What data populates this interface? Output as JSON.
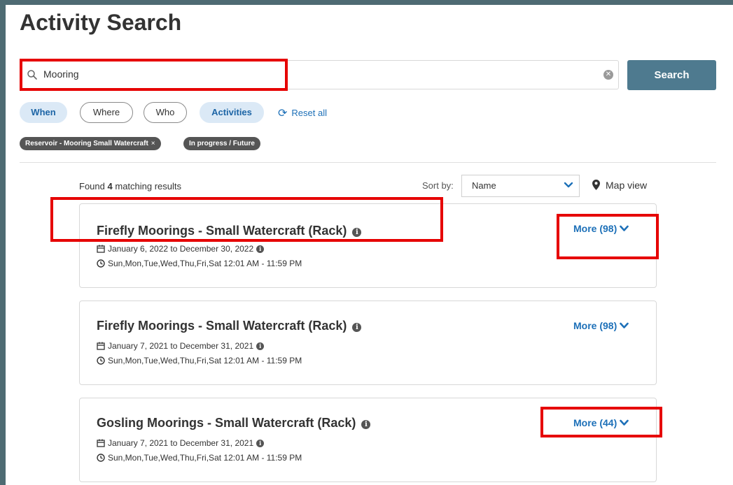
{
  "page": {
    "title": "Activity Search"
  },
  "search": {
    "value": "Mooring",
    "button_label": "Search"
  },
  "filters": {
    "pills": [
      {
        "label": "When",
        "active": true
      },
      {
        "label": "Where",
        "active": false
      },
      {
        "label": "Who",
        "active": false
      },
      {
        "label": "Activities",
        "active": true
      }
    ],
    "reset_label": "Reset all",
    "chips": [
      {
        "label": "Reservoir - Mooring Small Watercraft",
        "removable": true
      },
      {
        "label": "In progress / Future",
        "removable": false
      }
    ]
  },
  "results": {
    "found_prefix": "Found",
    "count": "4",
    "found_suffix": "matching results",
    "sort_label": "Sort by:",
    "sort_value": "Name",
    "map_view_label": "Map view",
    "items": [
      {
        "title": "Firefly Moorings - Small Watercraft (Rack)",
        "dates": "January 6, 2022 to December 30, 2022",
        "schedule": "Sun,Mon,Tue,Wed,Thu,Fri,Sat 12:01 AM - 11:59 PM",
        "more_label": "More (98)"
      },
      {
        "title": "Firefly Moorings - Small Watercraft (Rack)",
        "dates": "January 7, 2021 to December 31, 2021",
        "schedule": "Sun,Mon,Tue,Wed,Thu,Fri,Sat 12:01 AM - 11:59 PM",
        "more_label": "More (98)"
      },
      {
        "title": "Gosling Moorings - Small Watercraft (Rack)",
        "dates": "January 7, 2021 to December 31, 2021",
        "schedule": "Sun,Mon,Tue,Wed,Thu,Fri,Sat 12:01 AM - 11:59 PM",
        "more_label": "More (44)"
      }
    ]
  },
  "colors": {
    "accent": "#1d70b8",
    "button": "#4e7a8f",
    "frame": "#4e6b73",
    "annotation": "#e60000"
  }
}
